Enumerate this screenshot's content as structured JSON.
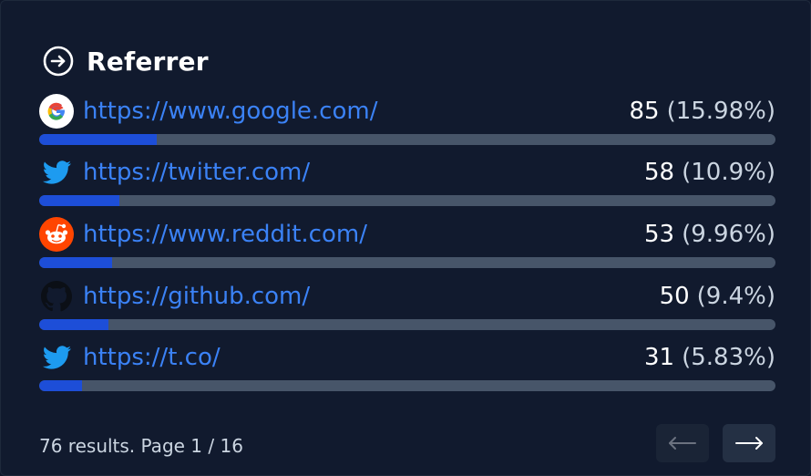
{
  "header": {
    "icon": "circle-arrow-right-icon",
    "title": "Referrer"
  },
  "referrers": [
    {
      "icon": "google-icon",
      "url": "https://www.google.com/",
      "count": "85",
      "percent": "(15.98%)",
      "share": 15.98
    },
    {
      "icon": "twitter-icon",
      "url": "https://twitter.com/",
      "count": "58",
      "percent": "(10.9%)",
      "share": 10.9
    },
    {
      "icon": "reddit-icon",
      "url": "https://www.reddit.com/",
      "count": "53",
      "percent": "(9.96%)",
      "share": 9.96
    },
    {
      "icon": "github-icon",
      "url": "https://github.com/",
      "count": "50",
      "percent": "(9.4%)",
      "share": 9.4
    },
    {
      "icon": "twitter-icon",
      "url": "https://t.co/",
      "count": "31",
      "percent": "(5.83%)",
      "share": 5.83
    }
  ],
  "pagination": {
    "summary": "76 results. Page 1 / 16",
    "prev_icon": "arrow-left-icon",
    "next_icon": "arrow-right-icon"
  },
  "colors": {
    "background": "#111a2e",
    "link": "#3b82f6",
    "bar_track": "#475569",
    "bar_fill": "#1d4ed8",
    "google_red": "#ea4335",
    "twitter_blue": "#1d9bf0",
    "reddit_orange": "#ff4500"
  }
}
